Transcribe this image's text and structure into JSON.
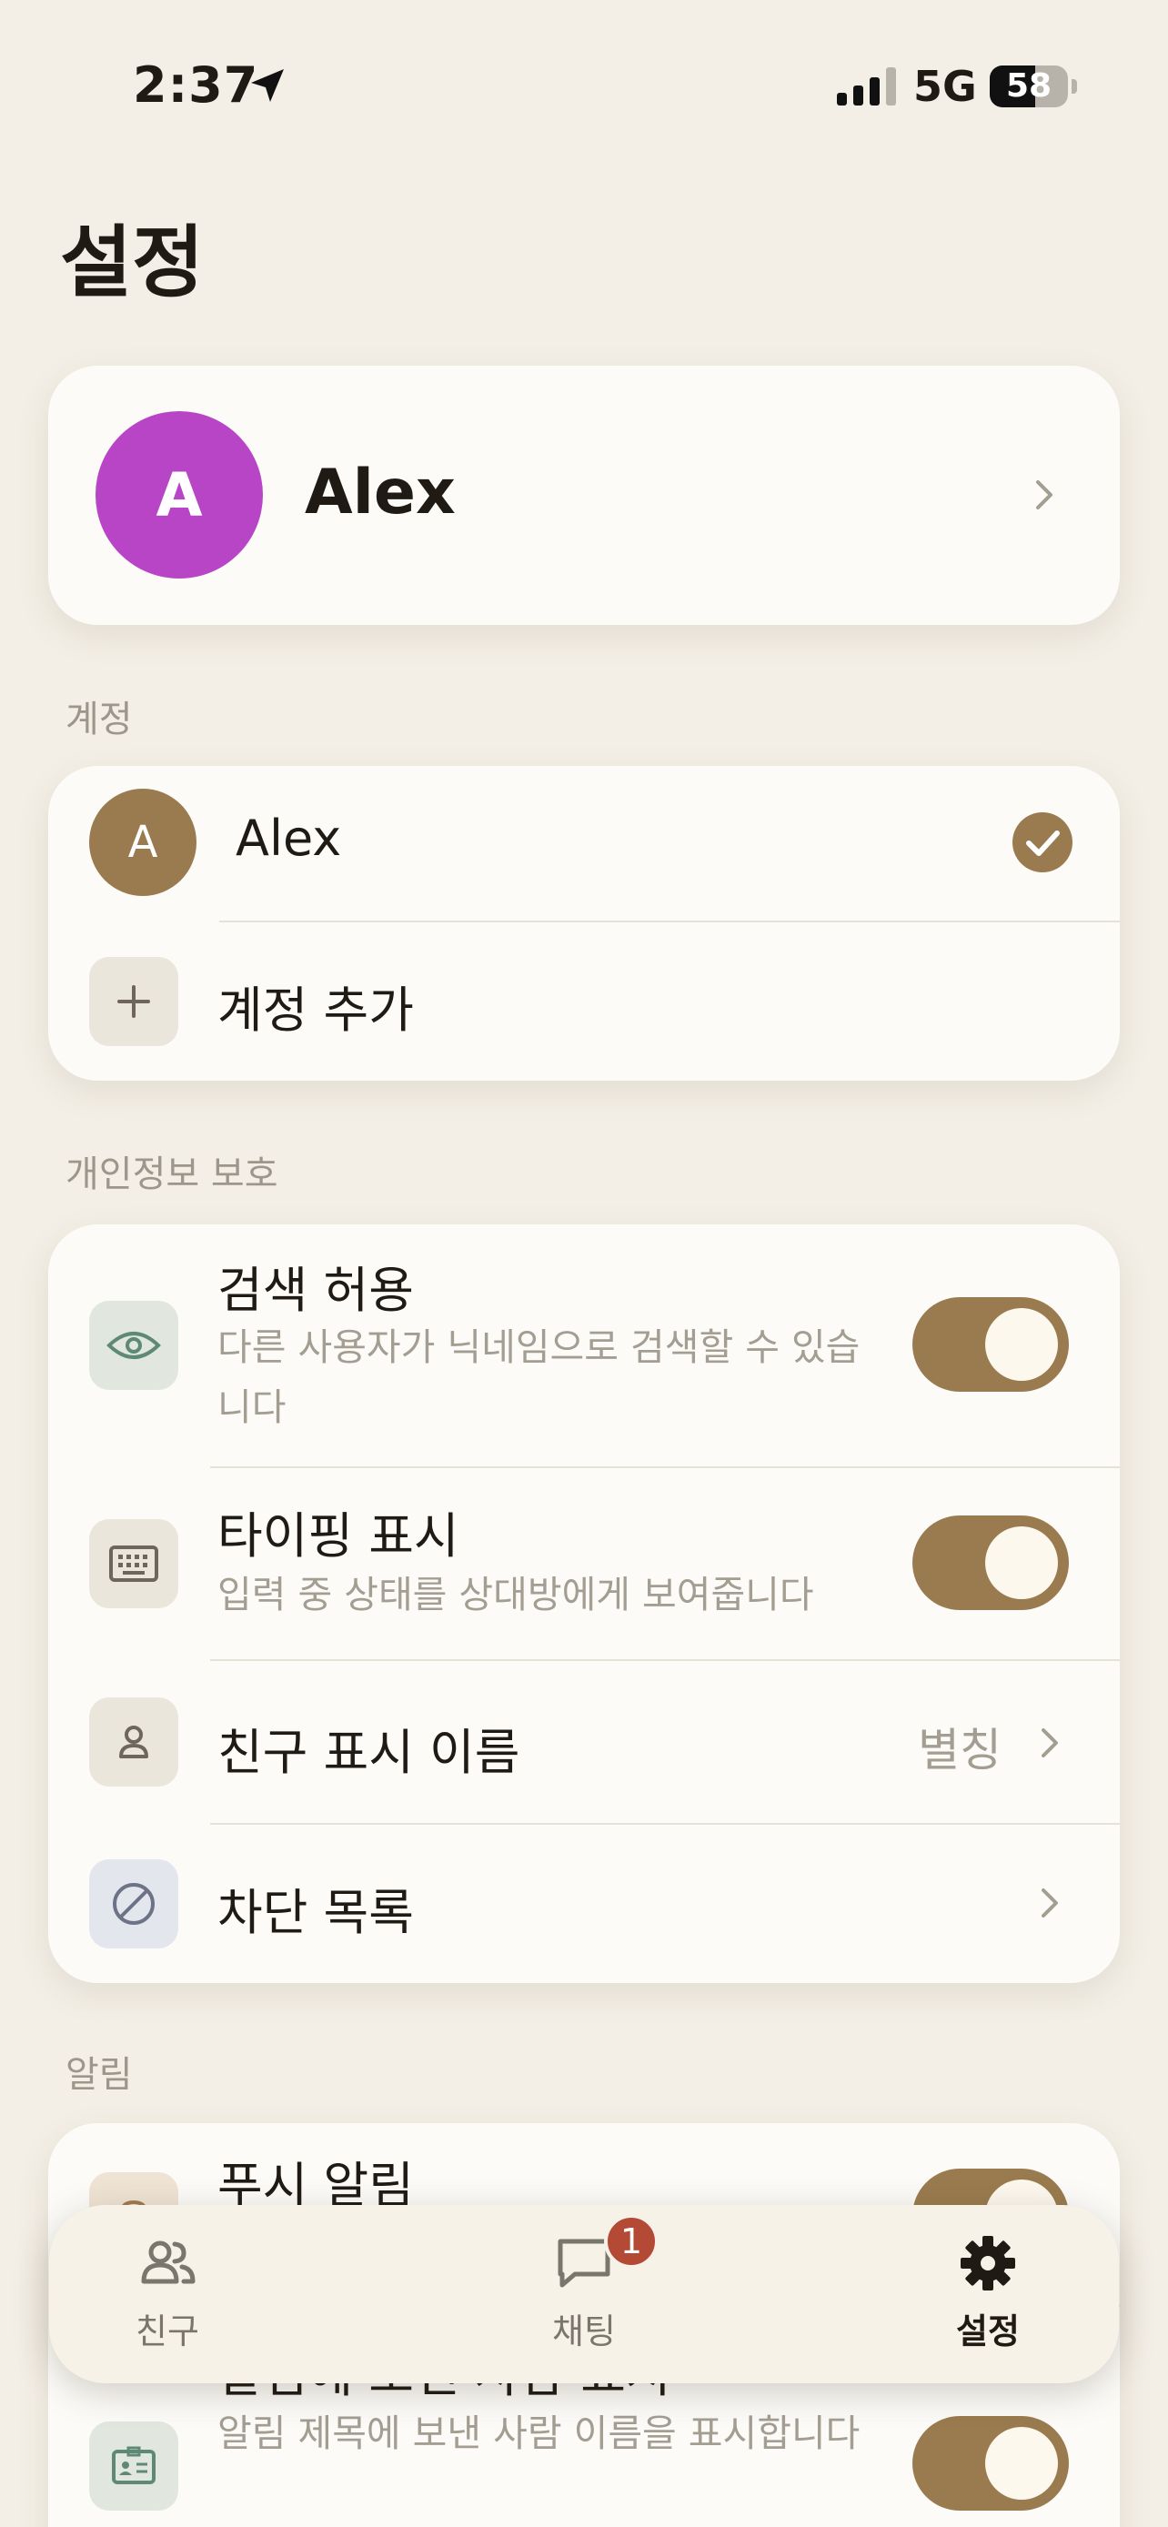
{
  "status_bar": {
    "time": "2:37",
    "network": "5G",
    "battery": "58",
    "battery_level": 0.58
  },
  "page_title": "설정",
  "profile": {
    "initial": "A",
    "name": "Alex",
    "avatar_color": "#b845c6"
  },
  "account_section": {
    "label": "계정",
    "accounts": [
      {
        "initial": "A",
        "name": "Alex",
        "selected": true
      }
    ],
    "add_label": "계정 추가"
  },
  "privacy_section": {
    "label": "개인정보 보호",
    "items": [
      {
        "title": "검색 허용",
        "subtitle": "다른 사용자가 닉네임으로 검색할 수 있습니다",
        "toggle": true,
        "icon": "eye-icon"
      },
      {
        "title": "타이핑 표시",
        "subtitle": "입력 중 상태를 상대방에게 보여줍니다",
        "toggle": true,
        "icon": "keyboard-icon"
      },
      {
        "title": "친구 표시 이름",
        "value": "별칭",
        "icon": "person-icon"
      },
      {
        "title": "차단 목록",
        "icon": "block-icon"
      }
    ]
  },
  "notifications_section": {
    "label": "알림",
    "items": [
      {
        "title": "푸시 알림",
        "toggle": true,
        "icon": "bell-icon"
      },
      {
        "title": "알림에 보낸 사람 표시",
        "subtitle": "알림 제목에 보낸 사람 이름을 표시합니다",
        "toggle": true,
        "icon": "id-card-icon"
      }
    ]
  },
  "tab_bar": {
    "tabs": [
      {
        "label": "친구",
        "icon": "friends-icon"
      },
      {
        "label": "채팅",
        "icon": "chat-icon",
        "badge": "1"
      },
      {
        "label": "설정",
        "icon": "gear-icon",
        "active": true
      }
    ]
  },
  "colors": {
    "accent": "#9a7b4f",
    "background": "#f3efe6",
    "card": "#fcfbf8",
    "badge": "#b44a36"
  }
}
